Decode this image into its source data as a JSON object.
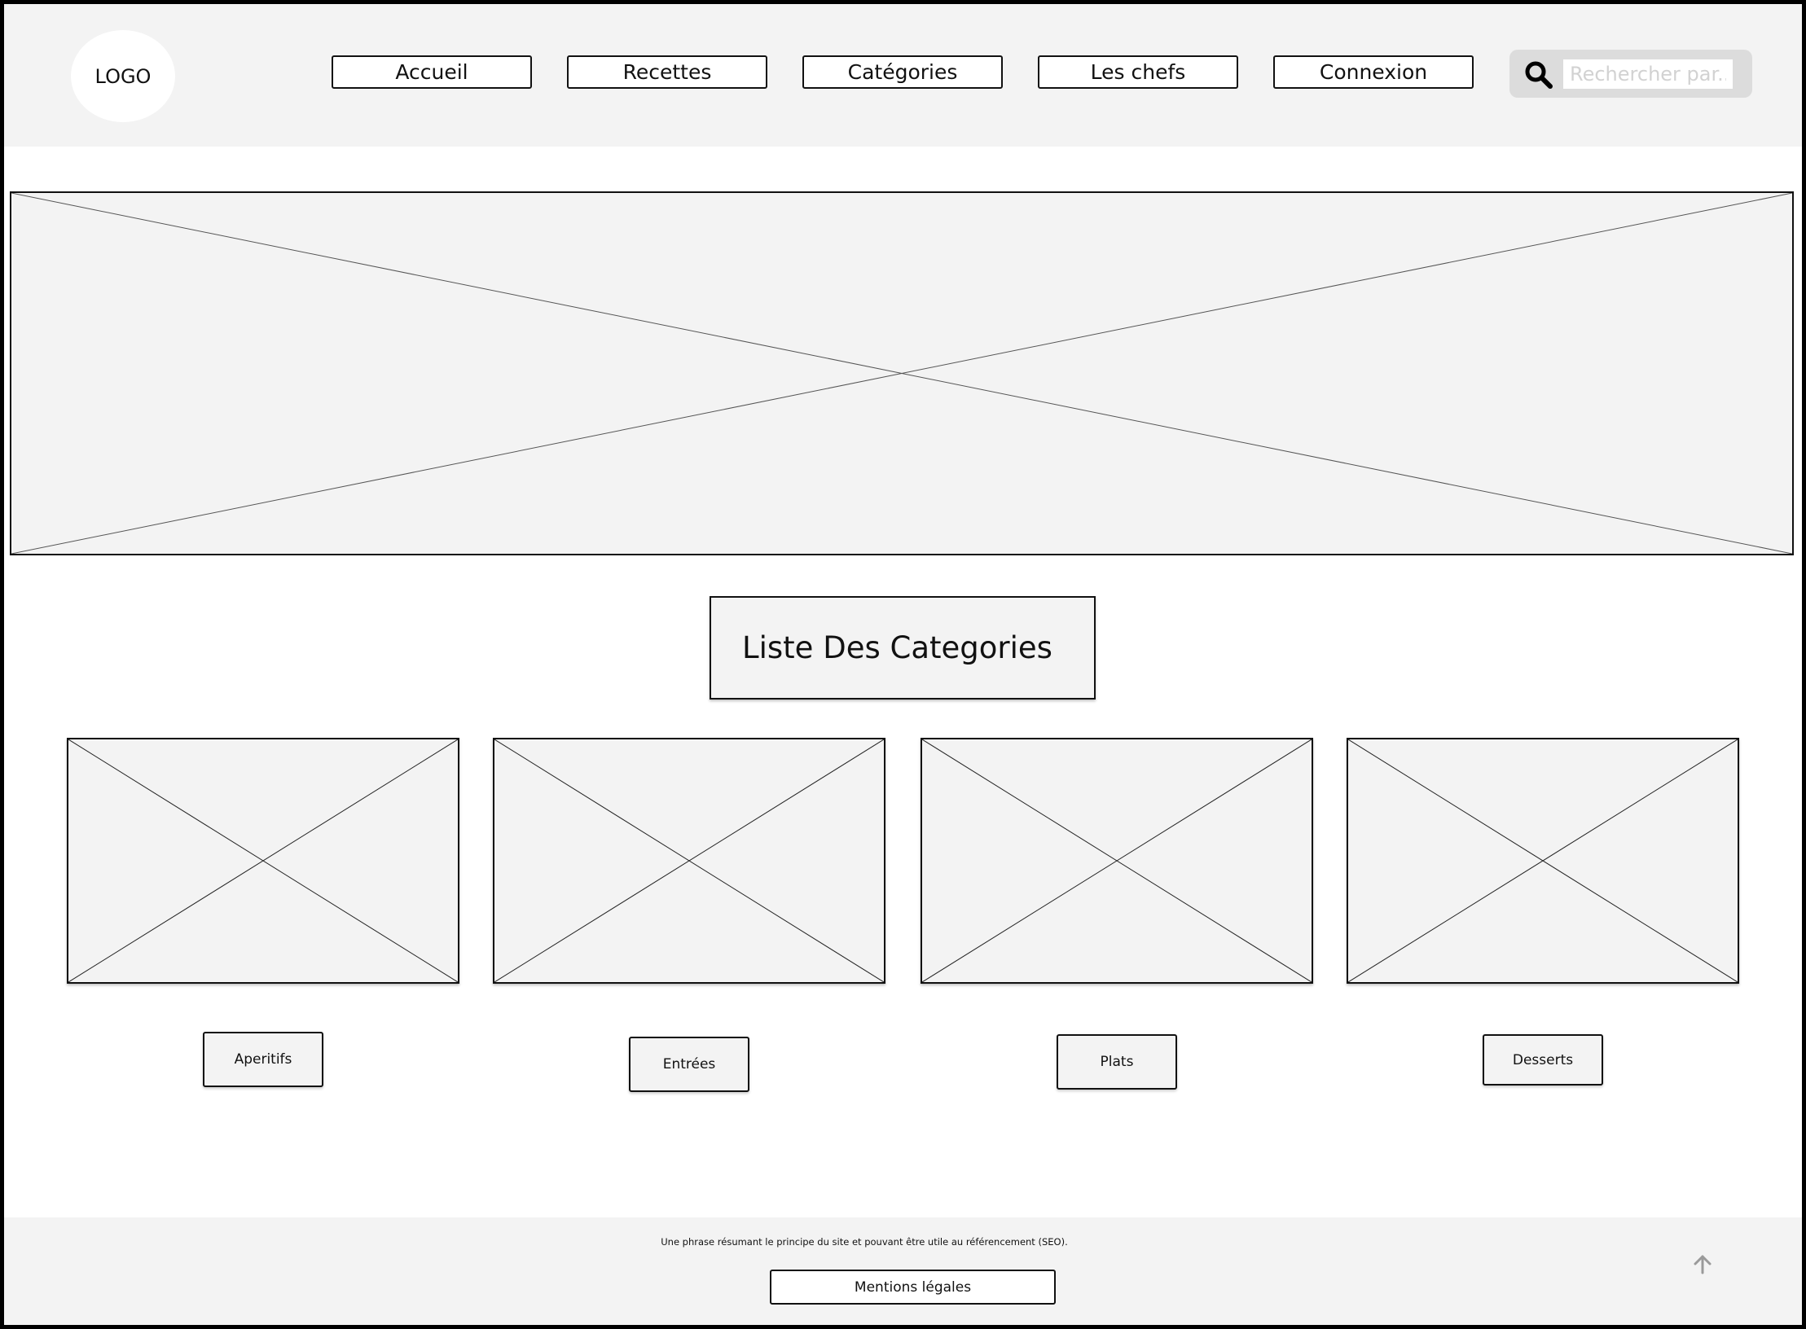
{
  "header": {
    "logo": "LOGO",
    "nav": [
      "Accueil",
      "Recettes",
      "Catégories",
      "Les chefs",
      "Connexion"
    ],
    "search": {
      "placeholder": "Rechercher par...",
      "value": ""
    }
  },
  "main": {
    "section_title": "Liste Des Categories",
    "categories": [
      "Aperitifs",
      "Entrées",
      "Plats",
      "Desserts"
    ]
  },
  "footer": {
    "text": "Une phrase résumant le principe du site et pouvant être utile au référencement (SEO).",
    "legal_label": "Mentions légales"
  },
  "icons": {
    "search": "search-icon",
    "back_to_top": "arrow-up-icon"
  },
  "colors": {
    "panel": "#f3f3f3",
    "border": "#111111",
    "search_bg": "#dcdcdc"
  }
}
